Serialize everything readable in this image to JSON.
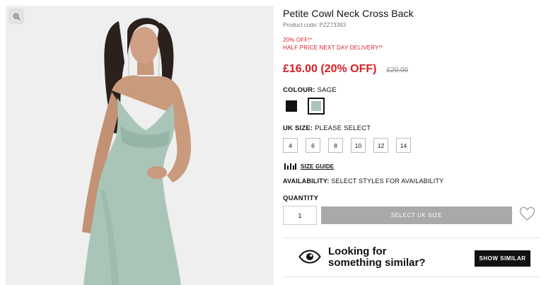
{
  "gallery": {
    "zoom_icon": "magnifier-zoom-icon",
    "photo_alt": "model wearing sage cowl neck dress"
  },
  "product": {
    "title": "Petite Cowl Neck Cross Back",
    "code": "Product code: PZZ73393",
    "promo_line_1": "20% OFF!*",
    "promo_line_2": "HALF PRICE NEXT DAY DELIVERY!*",
    "price_now": "£16.00 (20% OFF)",
    "price_was": "£20.00",
    "sale_color": "#d61f26"
  },
  "colour": {
    "label": "COLOUR:",
    "value": " SAGE",
    "swatches": [
      {
        "name": "black",
        "hex": "#111111",
        "selected": false
      },
      {
        "name": "sage",
        "hex": "#a9c5b8",
        "selected": true
      }
    ]
  },
  "size": {
    "label": "UK SIZE:",
    "value": " PLEASE SELECT",
    "options": [
      "4",
      "6",
      "8",
      "10",
      "12",
      "14"
    ],
    "guide_label": "SIZE GUIDE",
    "guide_icon": "ruler-icon"
  },
  "availability": {
    "label": "AVAILABILITY:",
    "value": "  SELECT STYLES FOR AVAILABILITY"
  },
  "quantity": {
    "label": "QUANTITY",
    "value": "1"
  },
  "cta": {
    "select_size_label": "SELECT UK SIZE",
    "wishlist_icon": "heart-icon"
  },
  "similar": {
    "line1": "Looking for",
    "line2": "something similar?",
    "button_label": "SHOW SIMILAR",
    "icon": "eye-icon"
  }
}
